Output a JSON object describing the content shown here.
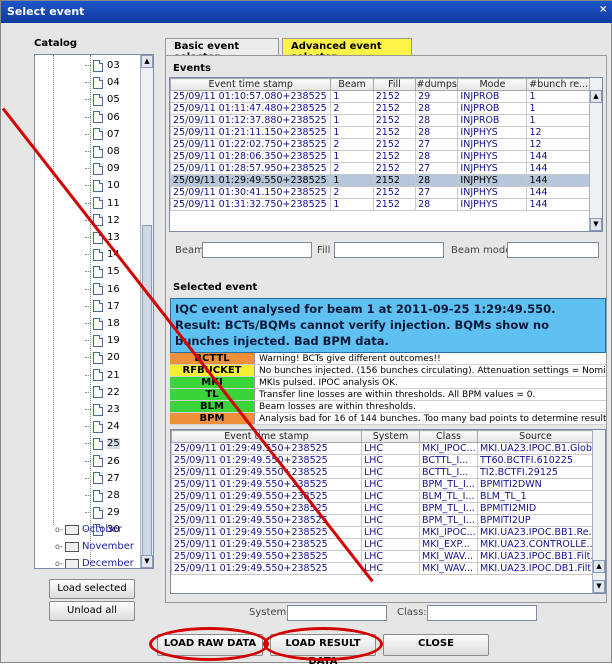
{
  "window": {
    "title": "Select event",
    "close": "×"
  },
  "catalog": {
    "label": "Catalog",
    "days": [
      "03",
      "04",
      "05",
      "06",
      "07",
      "08",
      "09",
      "10",
      "11",
      "12",
      "13",
      "14",
      "15",
      "16",
      "17",
      "18",
      "19",
      "20",
      "21",
      "22",
      "23",
      "24",
      "25",
      "26",
      "27",
      "28",
      "29",
      "30"
    ],
    "selected_day": "25",
    "months": [
      "October",
      "November",
      "December"
    ]
  },
  "buttons": {
    "load_selected": "Load selected",
    "unload_all": "Unload all",
    "load_raw": "LOAD RAW DATA",
    "load_result": "LOAD RESULT DATA",
    "close": "CLOSE"
  },
  "tabs": {
    "basic": "Basic event selector",
    "advanced": "Advanced event selector"
  },
  "events": {
    "label": "Events",
    "columns": [
      "Event time stamp",
      "Beam",
      "Fill",
      "#dumps",
      "Mode",
      "#bunch re..."
    ],
    "rows": [
      [
        "25/09/11 01:10:57.080+238525",
        "1",
        "2152",
        "29",
        "INJPROB",
        "1"
      ],
      [
        "25/09/11 01:11:47.480+238525",
        "2",
        "2152",
        "28",
        "INJPROB",
        "1"
      ],
      [
        "25/09/11 01:12:37.880+238525",
        "1",
        "2152",
        "28",
        "INJPROB",
        "1"
      ],
      [
        "25/09/11 01:21:11.150+238525",
        "1",
        "2152",
        "28",
        "INJPHYS",
        "12"
      ],
      [
        "25/09/11 01:22:02.750+238525",
        "2",
        "2152",
        "27",
        "INJPHYS",
        "12"
      ],
      [
        "25/09/11 01:28:06.350+238525",
        "1",
        "2152",
        "28",
        "INJPHYS",
        "144"
      ],
      [
        "25/09/11 01:28:57.950+238525",
        "2",
        "2152",
        "27",
        "INJPHYS",
        "144"
      ],
      [
        "25/09/11 01:29:49.550+238525",
        "1",
        "2152",
        "28",
        "INJPHYS",
        "144"
      ],
      [
        "25/09/11 01:30:41.150+238525",
        "2",
        "2152",
        "27",
        "INJPHYS",
        "144"
      ],
      [
        "25/09/11 01:31:32.750+238525",
        "1",
        "2152",
        "28",
        "INJPHYS",
        "144"
      ]
    ],
    "selected_row": 7
  },
  "filters": {
    "beam": "Beam",
    "fill": "Fill",
    "beam_mode": "Beam mode",
    "system": "System",
    "class": "Class:"
  },
  "selected_event": {
    "label": "Selected event",
    "result": "IQC event analysed for beam 1 at 2011-09-25 1:29:49.550.  Result: BCTs/BQMs cannot verify injection. BQMs show no bunches injected. Bad BPM data.",
    "checks": [
      {
        "name": "BCTTL",
        "color": "#f0903a",
        "msg": "Warning! BCTs give different outcomes!!"
      },
      {
        "name": "RFBUCKET",
        "color": "#f4ef32",
        "msg": "No bunches injected. (156 bunches circulating). Attenuation settings = Nomi..."
      },
      {
        "name": "MKI",
        "color": "#3ad33a",
        "msg": "MKIs pulsed. IPOC analysis OK."
      },
      {
        "name": "TL",
        "color": "#3ad33a",
        "msg": "Transfer line losses are within thresholds. All BPM values = 0."
      },
      {
        "name": "BLM",
        "color": "#3ad33a",
        "msg": "Beam losses are within thresholds."
      },
      {
        "name": "BPM",
        "color": "#f0903a",
        "msg": "Analysis bad for 16 of 144 bunches. Too many bad points to determine result."
      }
    ],
    "detail_columns": [
      "Event time stamp",
      "System",
      "Class",
      "Source"
    ],
    "detail_rows": [
      [
        "25/09/11 01:29:49.550+238525",
        "LHC",
        "MKI_IPOC...",
        "MKI.UA23.IPOC.B1.Glob..."
      ],
      [
        "25/09/11 01:29:49.550+238525",
        "LHC",
        "BCTTL_I...",
        "TT60.BCTFI.610225"
      ],
      [
        "25/09/11 01:29:49.550+238525",
        "LHC",
        "BCTTL_I...",
        "TI2.BCTFI.29125"
      ],
      [
        "25/09/11 01:29:49.550+238525",
        "LHC",
        "BPM_TL_I...",
        "BPMITI2DWN"
      ],
      [
        "25/09/11 01:29:49.550+238525",
        "LHC",
        "BLM_TL_I...",
        "BLM_TL_1"
      ],
      [
        "25/09/11 01:29:49.550+238525",
        "LHC",
        "BPM_TL_I...",
        "BPMITI2MID"
      ],
      [
        "25/09/11 01:29:49.550+238525",
        "LHC",
        "BPM_TL_I...",
        "BPMITI2UP"
      ],
      [
        "25/09/11 01:29:49.550+238525",
        "LHC",
        "MKI_IPOC...",
        "MKI.UA23.IPOC.BB1.Re..."
      ],
      [
        "25/09/11 01:29:49.550+238525",
        "LHC",
        "MKI_EXP...",
        "MKI.UA23.CONTROLLE..."
      ],
      [
        "25/09/11 01:29:49.550+238525",
        "LHC",
        "MKI_WAV...",
        "MKI.UA23.IPOC.BB1.Filt..."
      ],
      [
        "25/09/11 01:29:49.550+238525",
        "LHC",
        "MKI_WAV...",
        "MKI.UA23.IPOC.DB1.Filt..."
      ]
    ]
  }
}
